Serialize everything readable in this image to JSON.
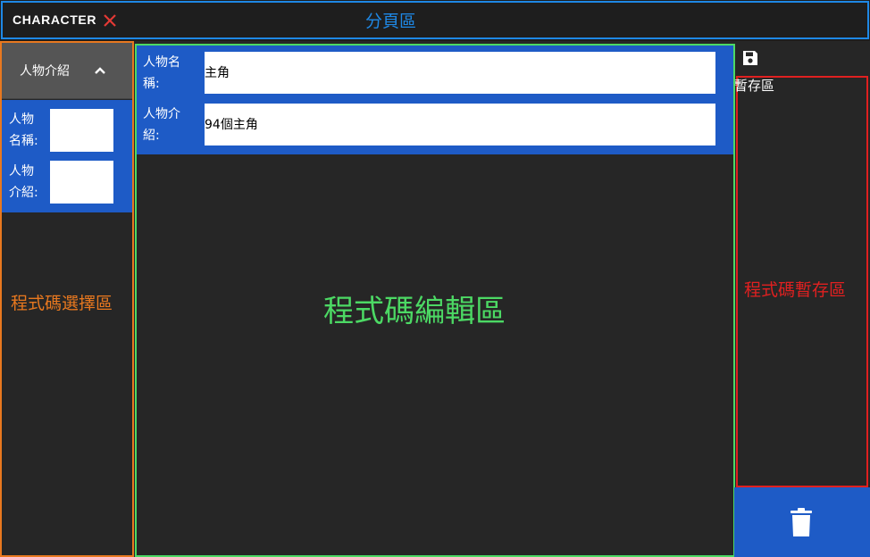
{
  "tabs": [
    {
      "label": "CHARACTER"
    }
  ],
  "tab_area_label": "分頁區",
  "left_panel": {
    "header_label": "人物介紹",
    "fields": [
      {
        "label_line1": "人物",
        "label_line2": "名稱:",
        "value": ""
      },
      {
        "label_line1": "人物",
        "label_line2": "介紹:",
        "value": ""
      }
    ],
    "zone_label": "程式碼選擇區"
  },
  "editor": {
    "fields": [
      {
        "label_line1": "人物名",
        "label_line2": "稱:",
        "value": "主角"
      },
      {
        "label_line1": "人物介",
        "label_line2": "紹:",
        "value": "94個主角"
      }
    ],
    "zone_label": "程式碼編輯區"
  },
  "right_panel": {
    "header": "暫存區",
    "zone_label": "程式碼暫存區"
  },
  "icons": {
    "close": "close-icon",
    "chevron": "chevron-up-icon",
    "save": "save-icon",
    "trash": "trash-icon"
  },
  "colors": {
    "tab_area": "#1e88e5",
    "select_area": "#e8781f",
    "edit_area": "#4cd964",
    "temp_area": "#e02020",
    "form_bg": "#1e5bc6",
    "close_icon": "#e53935"
  }
}
